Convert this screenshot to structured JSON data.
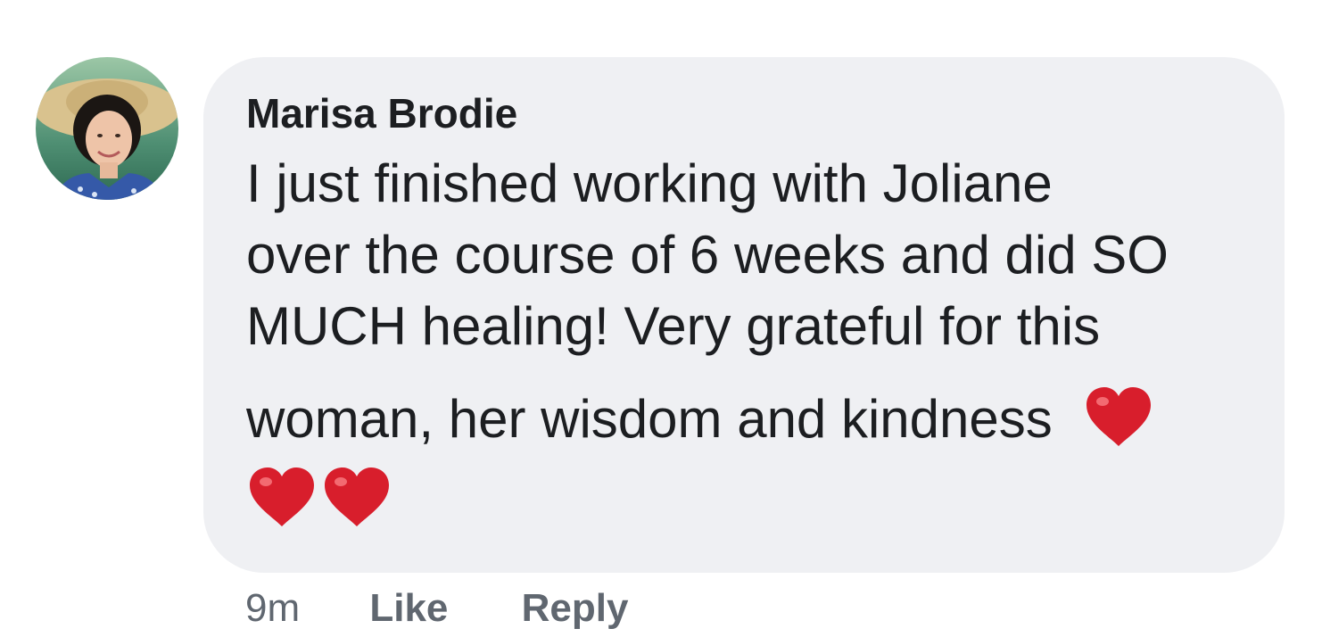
{
  "comment": {
    "author": "Marisa Brodie",
    "text_lines": [
      "I just finished working with Joliane",
      "over the course of 6 weeks and did SO",
      "MUCH healing! Very grateful for this",
      "woman, her wisdom and kindness"
    ],
    "emoji": "red-heart",
    "timestamp": "9m",
    "actions": {
      "like_label": "Like",
      "reply_label": "Reply"
    }
  },
  "colors": {
    "bubble_background": "#eff0f3",
    "author_text": "#1c1e21",
    "body_text": "#1c1e21",
    "meta_text": "#606770",
    "heart": "#d81e2c"
  }
}
